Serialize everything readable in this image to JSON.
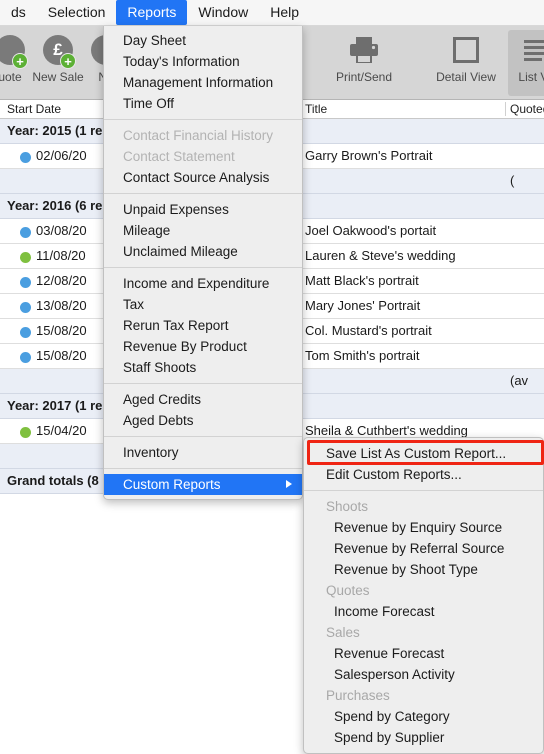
{
  "menubar": {
    "items": [
      {
        "label": "ds",
        "active": false
      },
      {
        "label": "Selection",
        "active": false
      },
      {
        "label": "Reports",
        "active": true
      },
      {
        "label": "Window",
        "active": false
      },
      {
        "label": "Help",
        "active": false
      }
    ]
  },
  "toolbar": {
    "buttons": [
      {
        "label": "uote",
        "icon": "new-quote-icon",
        "glyph": "",
        "selected": false
      },
      {
        "label": "New Sale",
        "icon": "new-sale-icon",
        "glyph": "£",
        "selected": false
      },
      {
        "label": "Ne",
        "icon": "new-icon",
        "glyph": "",
        "selected": false
      },
      {
        "label": "Print/Send",
        "icon": "printer-icon",
        "glyph": "",
        "selected": false
      },
      {
        "label": "Detail View",
        "icon": "detail-view-icon",
        "glyph": "",
        "selected": false
      },
      {
        "label": "List Vie",
        "icon": "list-view-icon",
        "glyph": "",
        "selected": true
      }
    ]
  },
  "listview": {
    "columns": [
      {
        "label": "Start Date"
      },
      {
        "label": "Title"
      },
      {
        "label": "Quoted"
      }
    ],
    "rows": [
      {
        "type": "group",
        "group": "Year: 2015 (1 re"
      },
      {
        "type": "data",
        "dot": "#4a9ee0",
        "date": "02/06/20",
        "title": "Garry Brown's Portrait",
        "quoted": ""
      },
      {
        "type": "summary",
        "group": "",
        "title": "",
        "quoted": "("
      },
      {
        "type": "group",
        "group": "Year: 2016 (6 re"
      },
      {
        "type": "data",
        "dot": "#4a9ee0",
        "date": "03/08/20",
        "title": "Joel Oakwood's portait",
        "quoted": ""
      },
      {
        "type": "data",
        "dot": "#7fc03f",
        "date": "11/08/20",
        "title": "Lauren & Steve's wedding",
        "quoted": ""
      },
      {
        "type": "data",
        "dot": "#4a9ee0",
        "date": "12/08/20",
        "title": "Matt Black's portrait",
        "quoted": ""
      },
      {
        "type": "data",
        "dot": "#4a9ee0",
        "date": "13/08/20",
        "title": "Mary Jones' Portrait",
        "quoted": ""
      },
      {
        "type": "data",
        "dot": "#4a9ee0",
        "date": "15/08/20",
        "title": "Col. Mustard's portrait",
        "quoted": ""
      },
      {
        "type": "data",
        "dot": "#4a9ee0",
        "date": "15/08/20",
        "title": "Tom Smith's portrait",
        "quoted": ""
      },
      {
        "type": "summary",
        "group": "",
        "title": "",
        "quoted": "(av"
      },
      {
        "type": "group",
        "group": "Year: 2017 (1 re"
      },
      {
        "type": "data",
        "dot": "#7fc03f",
        "date": "15/04/20",
        "title": "Sheila & Cuthbert's wedding",
        "quoted": ""
      },
      {
        "type": "summary",
        "group": "",
        "title": "",
        "quoted": "("
      },
      {
        "type": "group",
        "group": "Grand totals (8 "
      }
    ]
  },
  "reports_menu": {
    "items": [
      {
        "label": "Day Sheet",
        "state": "normal"
      },
      {
        "label": "Today's Information",
        "state": "normal"
      },
      {
        "label": "Management Information",
        "state": "normal"
      },
      {
        "label": "Time Off",
        "state": "normal"
      },
      {
        "label": "",
        "state": "separator"
      },
      {
        "label": "Contact Financial History",
        "state": "disabled"
      },
      {
        "label": "Contact Statement",
        "state": "disabled"
      },
      {
        "label": "Contact Source Analysis",
        "state": "normal"
      },
      {
        "label": "",
        "state": "separator"
      },
      {
        "label": "Unpaid Expenses",
        "state": "normal"
      },
      {
        "label": "Mileage",
        "state": "normal"
      },
      {
        "label": "Unclaimed Mileage",
        "state": "normal"
      },
      {
        "label": "",
        "state": "separator"
      },
      {
        "label": "Income and Expenditure",
        "state": "normal"
      },
      {
        "label": "Tax",
        "state": "normal"
      },
      {
        "label": "Rerun Tax Report",
        "state": "normal"
      },
      {
        "label": "Revenue By Product",
        "state": "normal"
      },
      {
        "label": "Staff Shoots",
        "state": "normal"
      },
      {
        "label": "",
        "state": "separator"
      },
      {
        "label": "Aged Credits",
        "state": "normal"
      },
      {
        "label": "Aged Debts",
        "state": "normal"
      },
      {
        "label": "",
        "state": "separator"
      },
      {
        "label": "Inventory",
        "state": "normal"
      },
      {
        "label": "",
        "state": "separator"
      },
      {
        "label": "Custom Reports",
        "state": "highlighted",
        "has_submenu": true
      }
    ]
  },
  "custom_reports_submenu": {
    "items": [
      {
        "label": "Save List As Custom Report...",
        "state": "normal",
        "annotated": true
      },
      {
        "label": "Edit Custom Reports...",
        "state": "normal"
      },
      {
        "label": "",
        "state": "separator"
      },
      {
        "label": "Shoots",
        "state": "section"
      },
      {
        "label": "Revenue by Enquiry Source",
        "state": "sub"
      },
      {
        "label": "Revenue by Referral Source",
        "state": "sub"
      },
      {
        "label": "Revenue by Shoot Type",
        "state": "sub"
      },
      {
        "label": "Quotes",
        "state": "section"
      },
      {
        "label": "Income Forecast",
        "state": "sub"
      },
      {
        "label": "Sales",
        "state": "section"
      },
      {
        "label": "Revenue Forecast",
        "state": "sub"
      },
      {
        "label": "Salesperson Activity",
        "state": "sub"
      },
      {
        "label": "Purchases",
        "state": "section"
      },
      {
        "label": "Spend by Category",
        "state": "sub"
      },
      {
        "label": "Spend by Supplier",
        "state": "sub"
      }
    ]
  },
  "annotation": {
    "color": "#ef2413",
    "target": "Save List As Custom Report..."
  }
}
